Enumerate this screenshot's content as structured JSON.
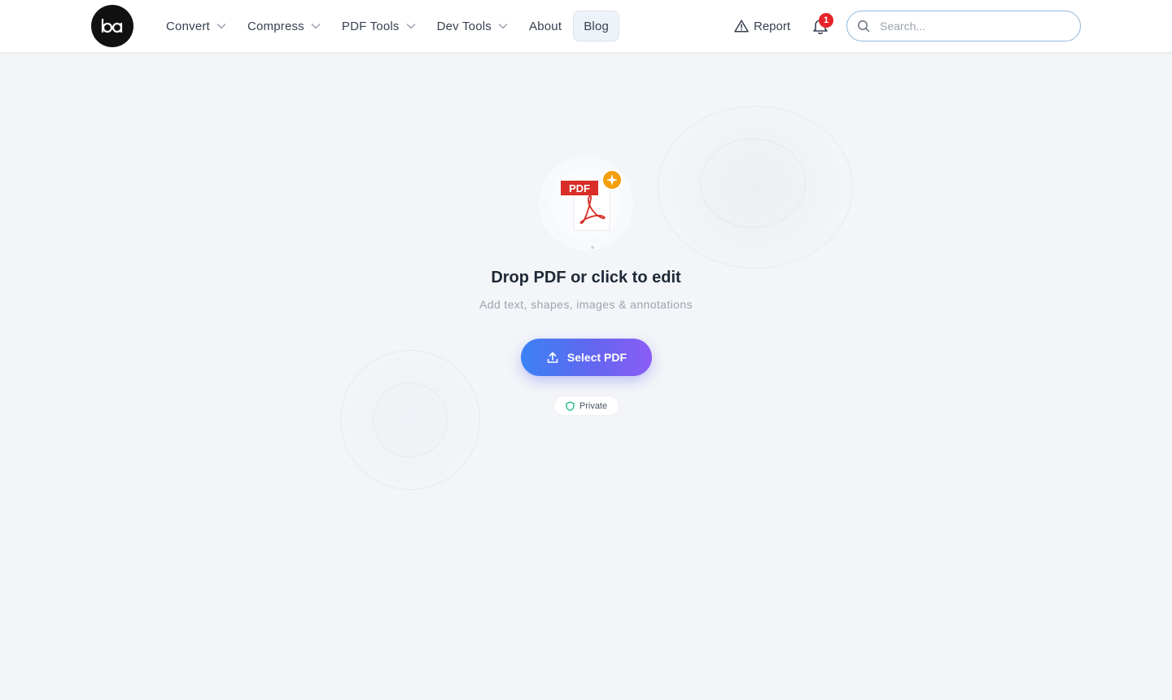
{
  "header": {
    "logo_text": "ba",
    "nav": [
      {
        "label": "Convert"
      },
      {
        "label": "Compress"
      },
      {
        "label": "PDF Tools"
      },
      {
        "label": "Dev Tools"
      },
      {
        "label": "About"
      },
      {
        "label": "Blog"
      }
    ],
    "report_label": "Report",
    "notification_count": "1",
    "search_placeholder": "Search..."
  },
  "hero": {
    "pdf_badge_text": "PDF",
    "title": "Drop PDF or click to edit",
    "subtitle": "Add text, shapes, images & annotations",
    "select_button_label": "Select PDF",
    "privacy_label": "Private"
  },
  "colors": {
    "background": "#f3f5f8",
    "button_gradient_start": "#3b82f6",
    "button_gradient_end": "#8b5cf6",
    "pdf_red": "#d92d27",
    "badge_red": "#e5252a",
    "sparkle_orange": "#f59e0b",
    "privacy_green": "#10b981"
  },
  "icons": [
    "logo",
    "chevron-down-icon",
    "warning-triangle-icon",
    "bell-icon",
    "search-icon",
    "pdf-file-icon",
    "sparkle-icon",
    "upload-icon",
    "shield-icon"
  ]
}
